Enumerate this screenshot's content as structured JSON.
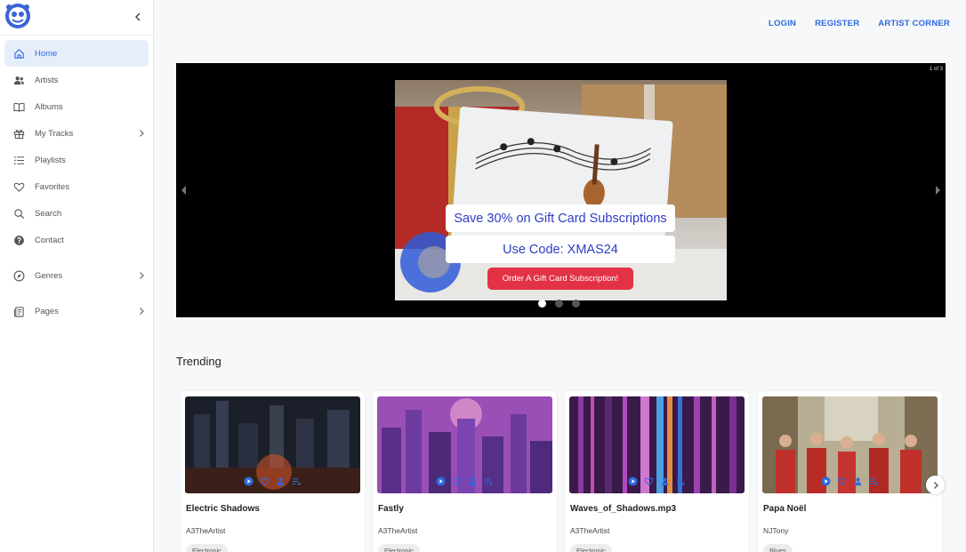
{
  "sidebar": {
    "items": [
      {
        "label": "Home",
        "icon": "home-icon",
        "active": true
      },
      {
        "label": "Artists",
        "icon": "artists-icon"
      },
      {
        "label": "Albums",
        "icon": "albums-icon"
      },
      {
        "label": "My Tracks",
        "icon": "gift-icon",
        "has_submenu": true
      },
      {
        "label": "Playlists",
        "icon": "list-icon"
      },
      {
        "label": "Favorites",
        "icon": "heart-icon"
      },
      {
        "label": "Search",
        "icon": "search-icon"
      },
      {
        "label": "Contact",
        "icon": "help-icon"
      },
      {
        "label": "Genres",
        "icon": "compass-icon",
        "has_submenu": true
      },
      {
        "label": "Pages",
        "icon": "pages-icon",
        "has_submenu": true
      }
    ]
  },
  "topnav": {
    "login": "LOGIN",
    "register": "REGISTER",
    "artist_corner": "ARTIST CORNER"
  },
  "carousel": {
    "slide_counter": "1 of 3",
    "promo_line1": "Save 30% on Gift Card Subscriptions",
    "promo_line2": "Use Code: XMAS24",
    "button_label": "Order A Gift Card Subscription!",
    "total_slides": 3,
    "active_slide": 1
  },
  "trending": {
    "title": "Trending",
    "cards": [
      {
        "title": "Electric Shadows",
        "artist": "A3TheArtist",
        "genre": "Electronic"
      },
      {
        "title": "Fastly",
        "artist": "A3TheArtist",
        "genre": "Electronic"
      },
      {
        "title": "Waves_of_Shadows.mp3",
        "artist": "A3TheArtist",
        "genre": "Electronic"
      },
      {
        "title": "Papa Noël",
        "artist": "NJTony",
        "genre": "Blues"
      }
    ]
  },
  "colors": {
    "accent": "#2d6ae0",
    "promo_text": "#2e3cc5",
    "promo_button": "#e33246"
  }
}
